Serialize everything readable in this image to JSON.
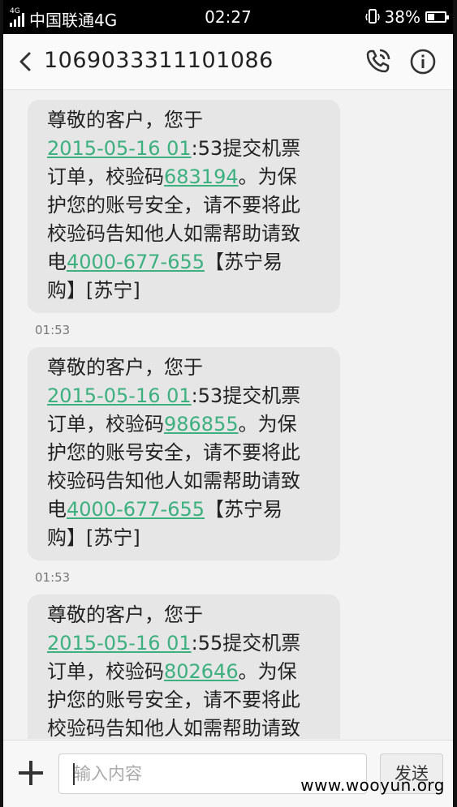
{
  "status_bar": {
    "network_type": "4G",
    "carrier": "中国联通4G",
    "time": "02:27",
    "battery_percent": "38%",
    "battery_level": 0.38
  },
  "header": {
    "contact_number": "1069033311101086",
    "icons": [
      "back-arrow-icon",
      "phone-call-icon",
      "info-icon"
    ]
  },
  "messages": [
    {
      "line1": "尊敬的客户，您于",
      "datetime_link": "2015-05-16 01",
      "after_datetime": ":53提交机票",
      "before_code": "订单，校验码",
      "code": "683194",
      "after_code": "。为保",
      "line4": "护您的账号安全，请不要将此",
      "line5": "校验码告知他人如需帮助请致",
      "before_phone": "电",
      "phone": "4000-677-655",
      "after_phone": "【苏宁易",
      "line7": "购】[苏宁]",
      "time": "01:53"
    },
    {
      "line1": "尊敬的客户，您于",
      "datetime_link": "2015-05-16 01",
      "after_datetime": ":53提交机票",
      "before_code": "订单，校验码",
      "code": "986855",
      "after_code": "。为保",
      "line4": "护您的账号安全，请不要将此",
      "line5": "校验码告知他人如需帮助请致",
      "before_phone": "电",
      "phone": "4000-677-655",
      "after_phone": "【苏宁易",
      "line7": "购】[苏宁]",
      "time": "01:53"
    },
    {
      "line1": "尊敬的客户，您于",
      "datetime_link": "2015-05-16 01",
      "after_datetime": ":55提交机票",
      "before_code": "订单，校验码",
      "code": "802646",
      "after_code": "。为保",
      "line4": "护您的账号安全，请不要将此",
      "line5": "校验码告知他人如需帮助请致"
    }
  ],
  "input_bar": {
    "placeholder": "输入内容",
    "send_label": "发送",
    "icons": [
      "plus-icon"
    ]
  },
  "watermark": "www.wooyun.org",
  "colors": {
    "link": "#3cb07e",
    "bubble": "#e6e6e6",
    "background": "#f2f2f2"
  }
}
